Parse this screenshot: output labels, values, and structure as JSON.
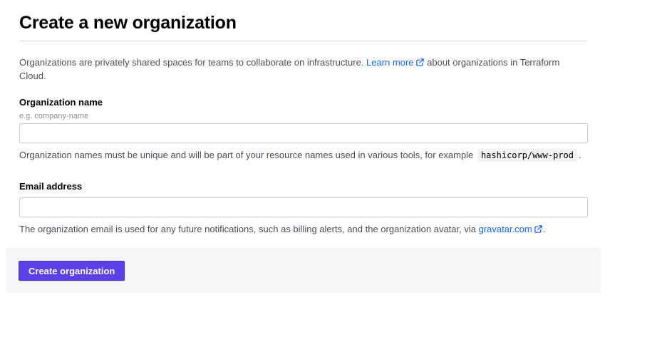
{
  "page": {
    "title": "Create a new organization"
  },
  "intro": {
    "text_before": "Organizations are privately shared spaces for teams to collaborate on infrastructure. ",
    "link_label": "Learn more",
    "text_after": " about organizations in Terraform Cloud."
  },
  "org_name": {
    "label": "Organization name",
    "hint": "e.g. company-name",
    "value": "",
    "help_before": "Organization names must be unique and will be part of your resource names used in various tools, for example ",
    "help_code": "hashicorp/www-prod",
    "help_after": "."
  },
  "email": {
    "label": "Email address",
    "value": "",
    "help_before": "The organization email is used for any future notifications, such as billing alerts, and the organization avatar, via ",
    "link_label": "gravatar.com",
    "help_after": "."
  },
  "actions": {
    "submit_label": "Create organization"
  },
  "colors": {
    "link": "#1563ff",
    "primary_button": "#5b3fe7",
    "footer_bg": "#f5f6f7"
  },
  "icons": {
    "external_link": "external-link-icon"
  }
}
